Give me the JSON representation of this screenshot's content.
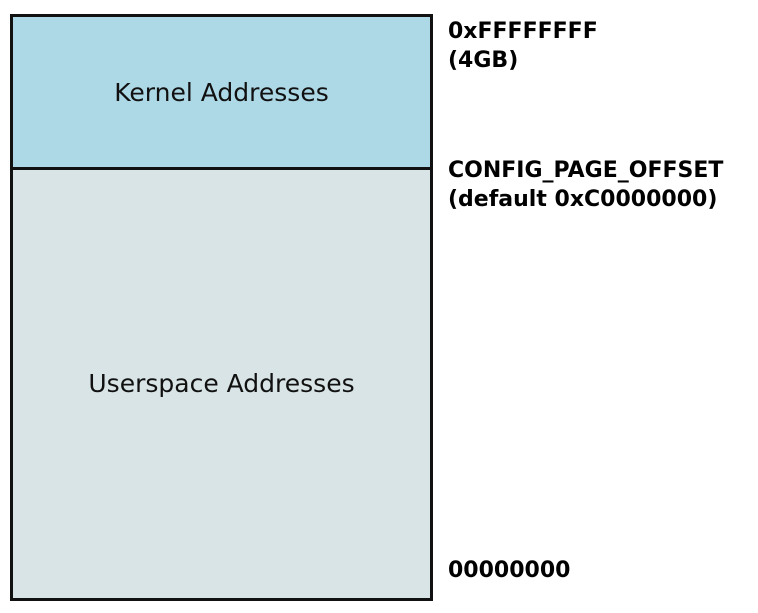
{
  "regions": {
    "kernel": {
      "label": "Kernel Addresses",
      "color": "#add8e6"
    },
    "userspace": {
      "label": "Userspace Addresses",
      "color": "#d8e4e6"
    }
  },
  "addresses": {
    "top": {
      "line1": "0xFFFFFFFF",
      "line2": "(4GB)"
    },
    "page_offset": {
      "line1": "CONFIG_PAGE_OFFSET",
      "line2": "(default 0xC0000000)"
    },
    "bottom": {
      "line1": "00000000"
    }
  }
}
